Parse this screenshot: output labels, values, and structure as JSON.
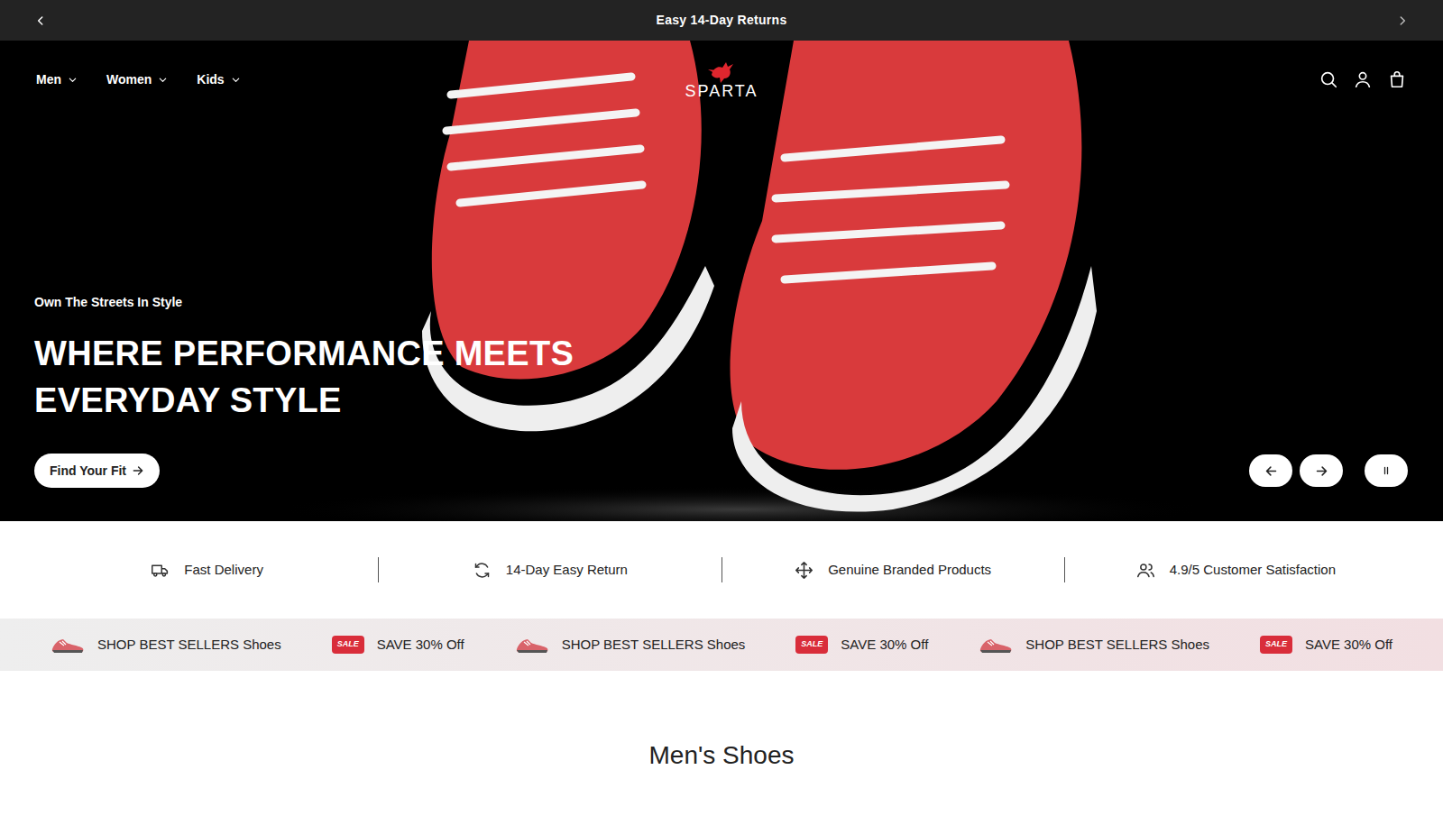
{
  "announcement": {
    "text": "Easy 14-Day Returns"
  },
  "nav": {
    "items": [
      {
        "label": "Men"
      },
      {
        "label": "Women"
      },
      {
        "label": "Kids"
      }
    ]
  },
  "logo": "SPARTA",
  "hero": {
    "eyebrow": "Own The Streets In Style",
    "heading_lines": [
      "WHERE PERFORMANCE MEETS",
      "EVERYDAY STYLE"
    ],
    "cta": "Find Your Fit",
    "autoplay": true
  },
  "features": [
    {
      "label": "Fast Delivery",
      "kind": "truck"
    },
    {
      "label": "14-Day Easy Return",
      "kind": "return"
    },
    {
      "label": "Genuine Branded Products",
      "kind": "genuine"
    },
    {
      "label": "4.9/5 Customer Satisfaction",
      "kind": "users"
    }
  ],
  "marquee": [
    {
      "kind": "bestseller",
      "text": "SHOP BEST SELLERS Shoes"
    },
    {
      "kind": "sale",
      "badge": "SALE",
      "text": "SAVE 30% Off"
    },
    {
      "kind": "bestseller",
      "text": "SHOP BEST SELLERS Shoes"
    },
    {
      "kind": "sale",
      "badge": "SALE",
      "text": "SAVE 30% Off"
    },
    {
      "kind": "bestseller",
      "text": "SHOP BEST SELLERS Shoes"
    },
    {
      "kind": "sale",
      "badge": "SALE",
      "text": "SAVE 30% Off"
    }
  ],
  "section_title": "Men's Shoes"
}
